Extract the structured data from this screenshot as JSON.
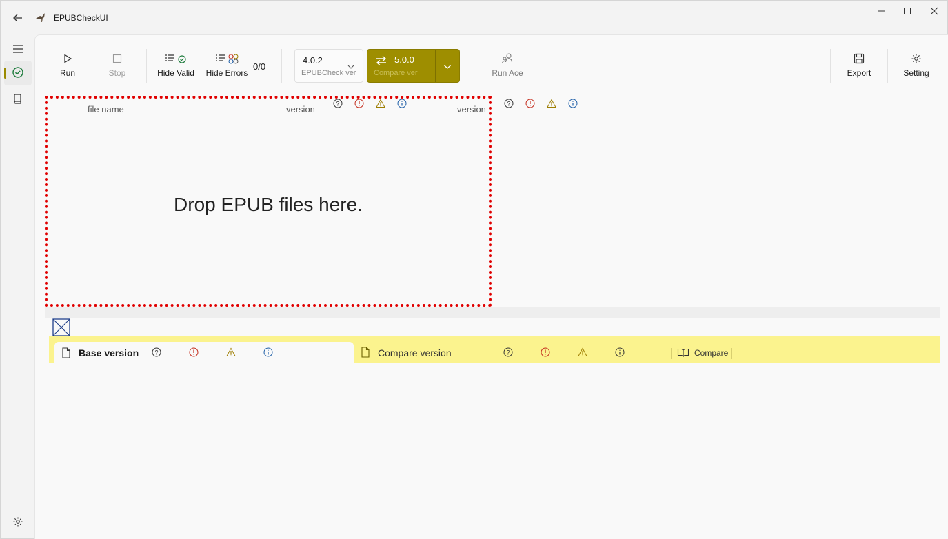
{
  "app": {
    "title": "EPUBCheckUI"
  },
  "toolbar": {
    "run_label": "Run",
    "stop_label": "Stop",
    "hide_valid_label": "Hide Valid",
    "hide_errors_label": "Hide Errors",
    "count": "0/0",
    "epubcheck_version": {
      "value": "4.0.2",
      "caption": "EPUBCheck ver"
    },
    "compare_version": {
      "value": "5.0.0",
      "caption": "Compare ver"
    },
    "run_ace_label": "Run Ace",
    "export_label": "Export",
    "setting_label": "Setting"
  },
  "grid": {
    "file_name_header": "file name",
    "version_header": "version",
    "compare_version_header": "version",
    "drop_text": "Drop EPUB files here."
  },
  "tabs": {
    "base_label": "Base version",
    "compare_label": "Compare version",
    "compare_button_label": "Compare"
  },
  "colors": {
    "accent": "#9e8e00",
    "drop_border": "#e00000",
    "tab_strip": "#fbf38e",
    "error": "#c42b1c",
    "warning": "#9d7d00",
    "info": "#1f5fa8"
  }
}
